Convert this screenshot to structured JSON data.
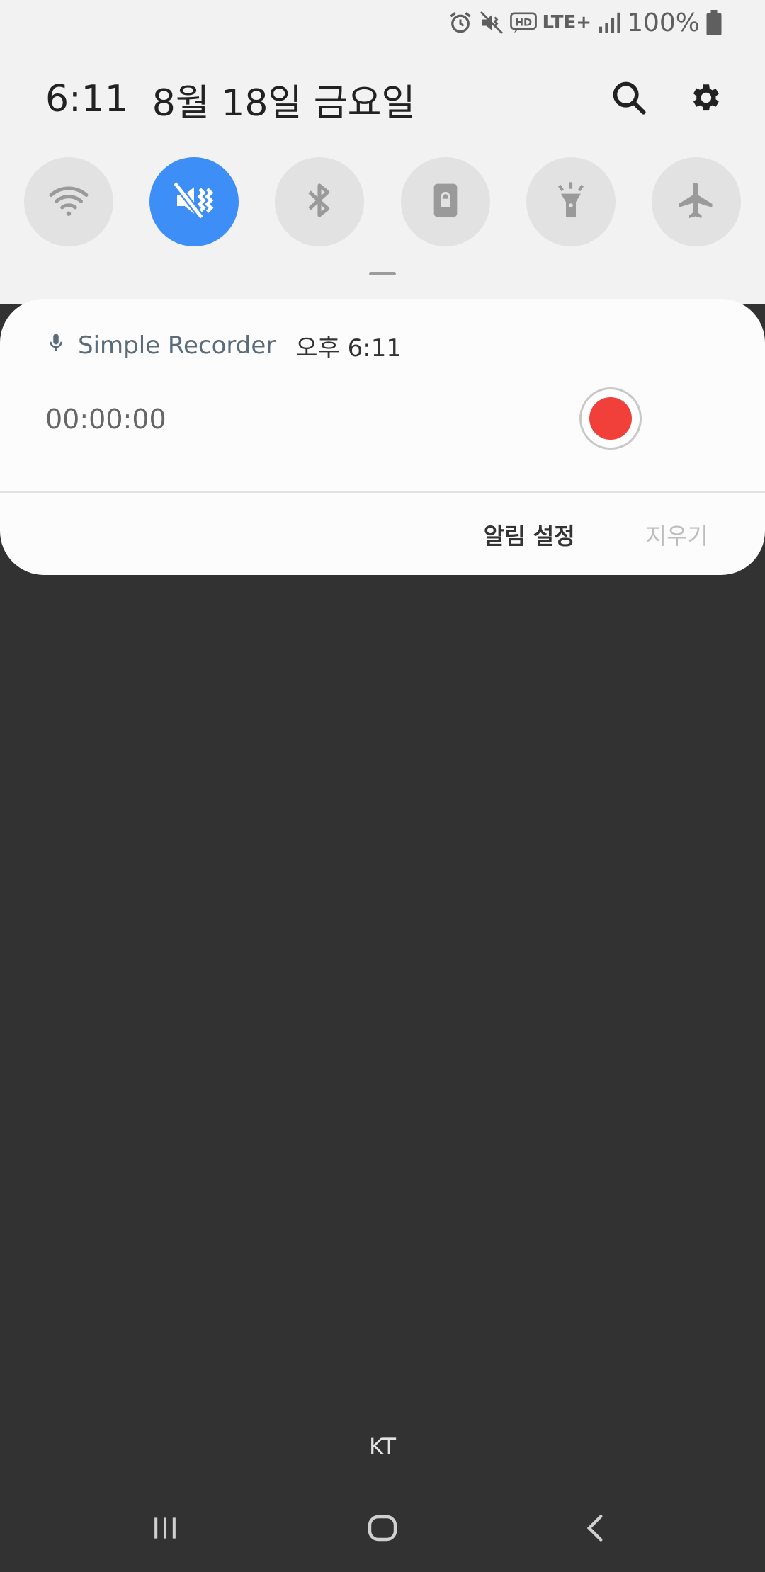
{
  "status_bar": {
    "battery_text": "100%",
    "network": "LTE+",
    "icons": [
      "alarm-icon",
      "mute-icon",
      "hd-voice-icon",
      "lte-icon",
      "signal-icon",
      "battery-icon"
    ]
  },
  "header": {
    "time": "6:11",
    "date": "8월 18일 금요일",
    "icons": [
      "search-icon",
      "settings-gear-icon"
    ]
  },
  "quick_settings": [
    {
      "name": "wifi",
      "icon": "wifi-icon",
      "active": false
    },
    {
      "name": "sound-vibrate",
      "icon": "vibrate-icon",
      "active": true
    },
    {
      "name": "bluetooth",
      "icon": "bluetooth-icon",
      "active": false
    },
    {
      "name": "screen-lock",
      "icon": "rotation-lock-icon",
      "active": false
    },
    {
      "name": "flashlight",
      "icon": "flashlight-icon",
      "active": false
    },
    {
      "name": "airplane",
      "icon": "airplane-icon",
      "active": false
    }
  ],
  "notification": {
    "app_name": "Simple Recorder",
    "time": "오후 6:11",
    "timer": "00:00:00",
    "actions": {
      "settings": "알림 설정",
      "clear": "지우기"
    }
  },
  "carrier": "KT",
  "colors": {
    "active_toggle": "#3e8ef7",
    "record": "#f1403a",
    "shade_background": "#323232"
  }
}
